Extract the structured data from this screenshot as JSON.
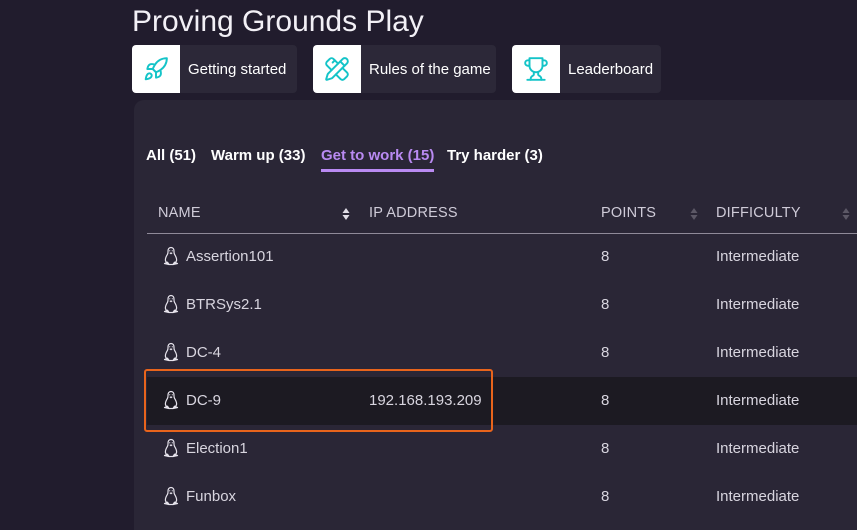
{
  "page": {
    "title": "Proving Grounds Play"
  },
  "quick_links": [
    {
      "label": "Getting started",
      "icon": "rocket-icon"
    },
    {
      "label": "Rules of the game",
      "icon": "pencil-ruler-icon"
    },
    {
      "label": "Leaderboard",
      "icon": "trophy-icon"
    }
  ],
  "filters": [
    {
      "label": "All (51)",
      "active": false
    },
    {
      "label": "Warm up (33)",
      "active": false
    },
    {
      "label": "Get to work (15)",
      "active": true
    },
    {
      "label": "Try harder (3)",
      "active": false
    }
  ],
  "table": {
    "columns": [
      "NAME",
      "IP ADDRESS",
      "POINTS",
      "DIFFICULTY"
    ],
    "rows": [
      {
        "name": "Assertion101",
        "ip": "",
        "points": "8",
        "difficulty": "Intermediate",
        "os": "linux-icon"
      },
      {
        "name": "BTRSys2.1",
        "ip": "",
        "points": "8",
        "difficulty": "Intermediate",
        "os": "linux-icon"
      },
      {
        "name": "DC-4",
        "ip": "",
        "points": "8",
        "difficulty": "Intermediate",
        "os": "linux-icon"
      },
      {
        "name": "DC-9",
        "ip": "192.168.193.209",
        "points": "8",
        "difficulty": "Intermediate",
        "os": "linux-icon",
        "selected": true
      },
      {
        "name": "Election1",
        "ip": "",
        "points": "8",
        "difficulty": "Intermediate",
        "os": "linux-icon"
      },
      {
        "name": "Funbox",
        "ip": "",
        "points": "8",
        "difficulty": "Intermediate",
        "os": "linux-icon"
      }
    ]
  },
  "colors": {
    "background": "#211c2d",
    "panel": "#2a2636",
    "accent": "#b98af2",
    "icon_teal": "#14c4c8",
    "highlight": "#e8641c"
  }
}
